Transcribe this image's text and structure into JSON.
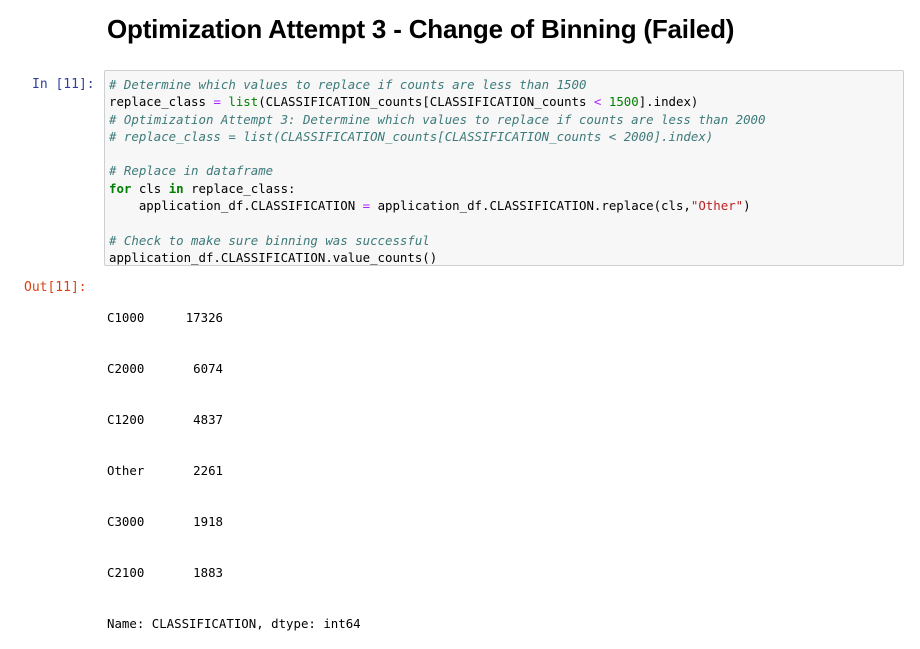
{
  "heading": "Optimization Attempt 3 - Change of Binning (Failed)",
  "cell": {
    "in_prompt": "In [11]:",
    "out_prompt": "Out[11]:",
    "code": {
      "l1_comment": "# Determine which values to replace if counts are less than 1500",
      "l2_a": "replace_class ",
      "l2_eq": "=",
      "l2_b": " ",
      "l2_builtin": "list",
      "l2_c": "(CLASSIFICATION_counts[CLASSIFICATION_counts ",
      "l2_lt": "<",
      "l2_d": " ",
      "l2_num": "1500",
      "l2_e": "].index)",
      "l3_comment": "# Optimization Attempt 3: Determine which values to replace if counts are less than 2000",
      "l4_comment": "# replace_class = list(CLASSIFICATION_counts[CLASSIFICATION_counts < 2000].index)",
      "l6_comment": "# Replace in dataframe",
      "l7_for": "for",
      "l7_a": " cls ",
      "l7_in": "in",
      "l7_b": " replace_class:",
      "l8_a": "    application_df.CLASSIFICATION ",
      "l8_eq": "=",
      "l8_b": " application_df.CLASSIFICATION.replace(cls,",
      "l8_str": "\"Other\"",
      "l8_c": ")",
      "l10_comment": "# Check to make sure binning was successful",
      "l11": "application_df.CLASSIFICATION.value_counts()"
    },
    "output": {
      "rows": [
        {
          "label": "C1000",
          "value": "17326"
        },
        {
          "label": "C2000",
          "value": "6074"
        },
        {
          "label": "C1200",
          "value": "4837"
        },
        {
          "label": "Other",
          "value": "2261"
        },
        {
          "label": "C3000",
          "value": "1918"
        },
        {
          "label": "C2100",
          "value": "1883"
        }
      ],
      "footer": "Name: CLASSIFICATION, dtype: int64"
    }
  }
}
